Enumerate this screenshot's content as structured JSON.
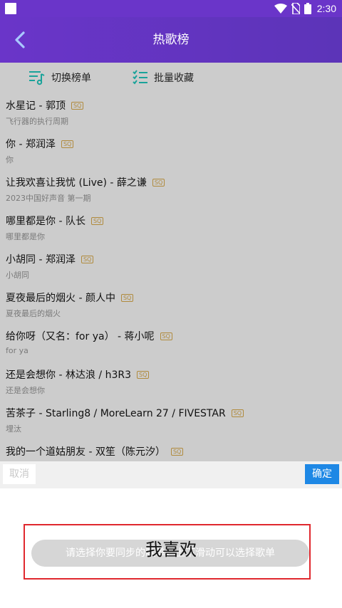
{
  "status_bar": {
    "time": "2:30"
  },
  "header": {
    "title": "热歌榜",
    "back_icon": "back-arrow-icon"
  },
  "toolbar": {
    "switch_label": "切换榜单",
    "collect_label": "批量收藏"
  },
  "quality_badge": "SQ",
  "songs": [
    {
      "title": "水星记 - 郭顶",
      "subtitle": "飞行器的执行周期"
    },
    {
      "title": "你 - 郑润泽",
      "subtitle": "你"
    },
    {
      "title": "让我欢喜让我忧 (Live) - 薛之谦",
      "subtitle": "2023中国好声音 第一期"
    },
    {
      "title": "哪里都是你 - 队长",
      "subtitle": "哪里都是你"
    },
    {
      "title": "小胡同 - 郑润泽",
      "subtitle": "小胡同"
    },
    {
      "title": "夏夜最后的烟火 - 颜人中",
      "subtitle": "夏夜最后的烟火"
    },
    {
      "title": "给你呀（又名：for ya） - 蒋小呢",
      "subtitle": "for ya"
    },
    {
      "title": "还是会想你 - 林达浪 / h3R3",
      "subtitle": "还是会想你"
    },
    {
      "title": "苦茶子 - Starling8 / MoreLearn 27 / FIVESTAR",
      "subtitle": "埋汰"
    },
    {
      "title": "我的一个道姑朋友 - 双笙（陈元汐）",
      "subtitle": ""
    }
  ],
  "actions": {
    "cancel_label": "取消",
    "confirm_label": "确定"
  },
  "toast": {
    "text": "请选择你要同步的歌单，上下滑动可以选择歌单"
  },
  "overlay_label": "我喜欢",
  "colors": {
    "header": "#6a35c9",
    "confirm": "#1e88e5",
    "highlight": "#e0282e",
    "badge": "#b08a3c"
  }
}
